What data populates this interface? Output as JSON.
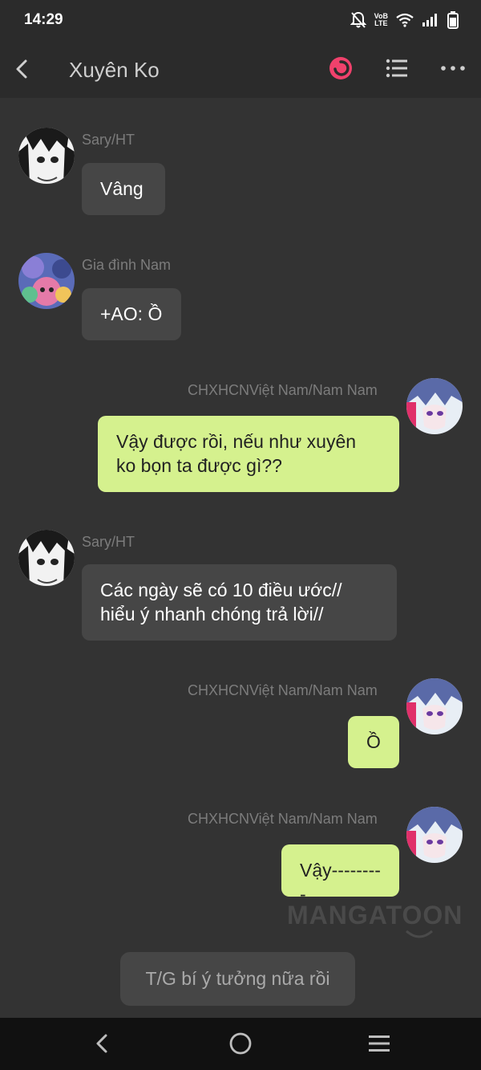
{
  "status_bar": {
    "time": "14:29",
    "network_label_top": "VoB",
    "network_label_bottom": "LTE"
  },
  "header": {
    "title": "Xuyên Ko"
  },
  "messages": [
    {
      "sender": "Sary/HT",
      "text": "Vâng",
      "side": "left"
    },
    {
      "sender": "Gia đình Nam",
      "text": "+AO: Ồ",
      "side": "left"
    },
    {
      "sender": "CHXHCNViệt Nam/Nam Nam",
      "lines": [
        "Vậy được rồi, nếu như xuyên",
        "ko bọn ta được gì??"
      ],
      "side": "right"
    },
    {
      "sender": "Sary/HT",
      "lines": [
        "Các ngày sẽ có 10 điều ước//",
        "hiểu ý nhanh chóng trả lời//"
      ],
      "side": "left"
    },
    {
      "sender": "CHXHCNViệt Nam/Nam Nam",
      "text": "Ồ",
      "side": "right"
    },
    {
      "sender": "CHXHCNViệt Nam/Nam Nam",
      "text": "Vậy---------",
      "side": "right"
    }
  ],
  "watermark": "MANGATOON",
  "narration": "T/G bí ý tưởng nữa rồi",
  "colors": {
    "background": "#333333",
    "incoming_bubble": "#464646",
    "outgoing_bubble": "#d5f18e",
    "record_button": "#f0416c"
  }
}
